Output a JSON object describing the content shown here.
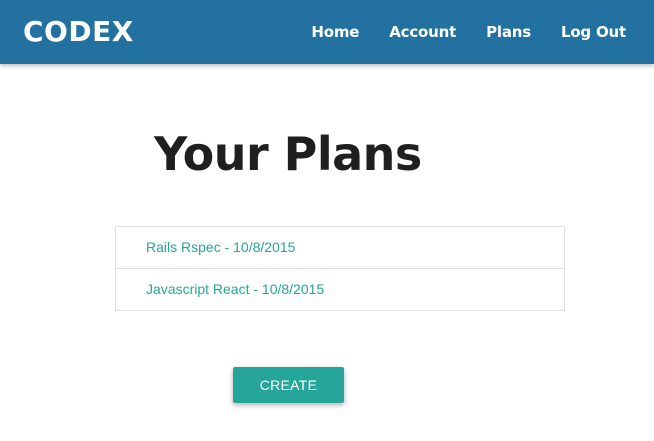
{
  "navbar": {
    "brand": "CODEX",
    "links": [
      {
        "label": "Home"
      },
      {
        "label": "Account"
      },
      {
        "label": "Plans"
      },
      {
        "label": "Log Out"
      }
    ],
    "background_color": "#2271a0"
  },
  "main": {
    "title": "Your Plans",
    "plans": [
      {
        "label": "Rails Rspec - 10/8/2015"
      },
      {
        "label": "Javascript React - 10/8/2015"
      }
    ],
    "create_label": "CREATE",
    "accent_color": "#26a69a"
  }
}
